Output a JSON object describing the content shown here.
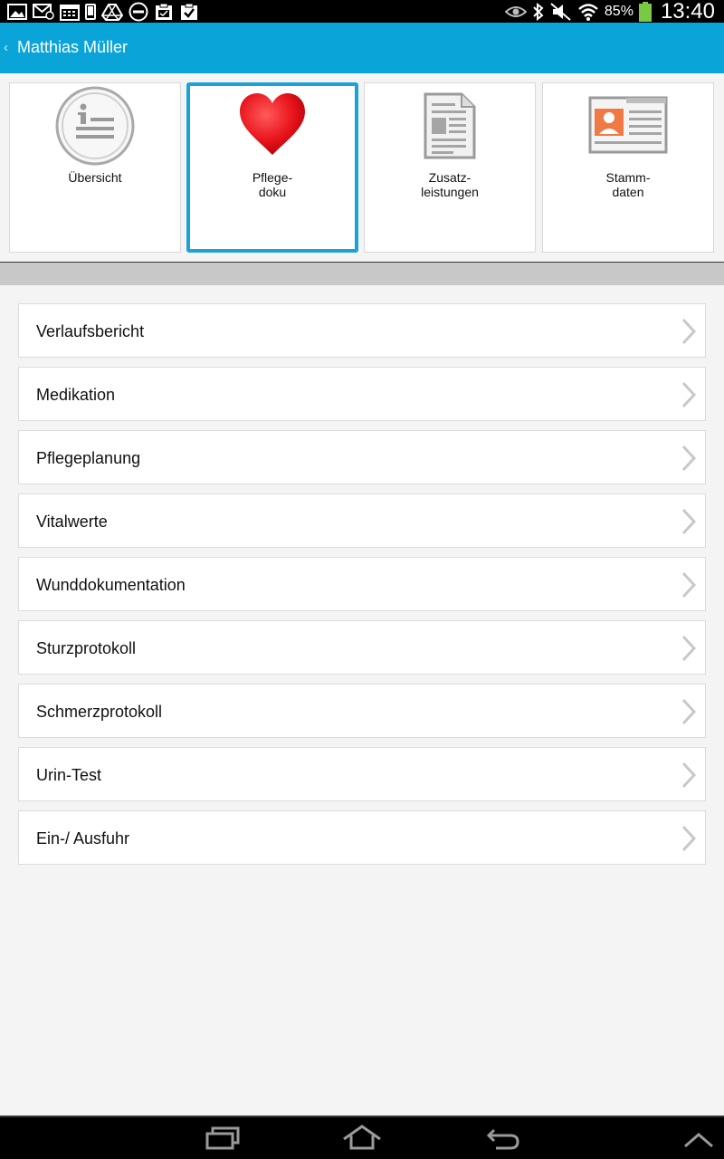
{
  "status_bar": {
    "notification_icons": [
      "image-icon",
      "mail-icon",
      "calendar-icon",
      "phone-icon",
      "drive-icon",
      "do-not-disturb-icon",
      "clipboard-icon",
      "clipboard-check-icon"
    ],
    "system_icons": [
      "eye-icon",
      "bluetooth-icon",
      "mute-icon",
      "wifi-icon"
    ],
    "battery_percent": "85%",
    "time": "13:40",
    "battery_color": "#7ac943"
  },
  "action_bar": {
    "back_glyph": "‹",
    "title": "Matthias Müller",
    "color": "#0aa4d8"
  },
  "tiles": [
    {
      "label_lines": [
        "Übersicht"
      ],
      "icon": "info-list-icon",
      "selected": false
    },
    {
      "label_lines": [
        "Pflege-",
        "doku"
      ],
      "icon": "heart-icon",
      "selected": true
    },
    {
      "label_lines": [
        "Zusatz-",
        "leistungen"
      ],
      "icon": "document-icon",
      "selected": false
    },
    {
      "label_lines": [
        "Stamm-",
        "daten"
      ],
      "icon": "id-card-icon",
      "selected": false
    }
  ],
  "menu": {
    "items": [
      "Verlaufsbericht",
      "Medikation",
      "Pflegeplanung",
      "Vitalwerte",
      "Wunddokumentation",
      "Sturzprotokoll",
      "Schmerzprotokoll",
      "Urin-Test",
      "Ein-/ Ausfuhr"
    ]
  },
  "nav_bar": {
    "buttons": [
      "recent-apps-icon",
      "home-icon",
      "back-icon",
      "expand-up-icon"
    ]
  },
  "colors": {
    "accent": "#1aa3d4",
    "heart": "#e8141b"
  }
}
